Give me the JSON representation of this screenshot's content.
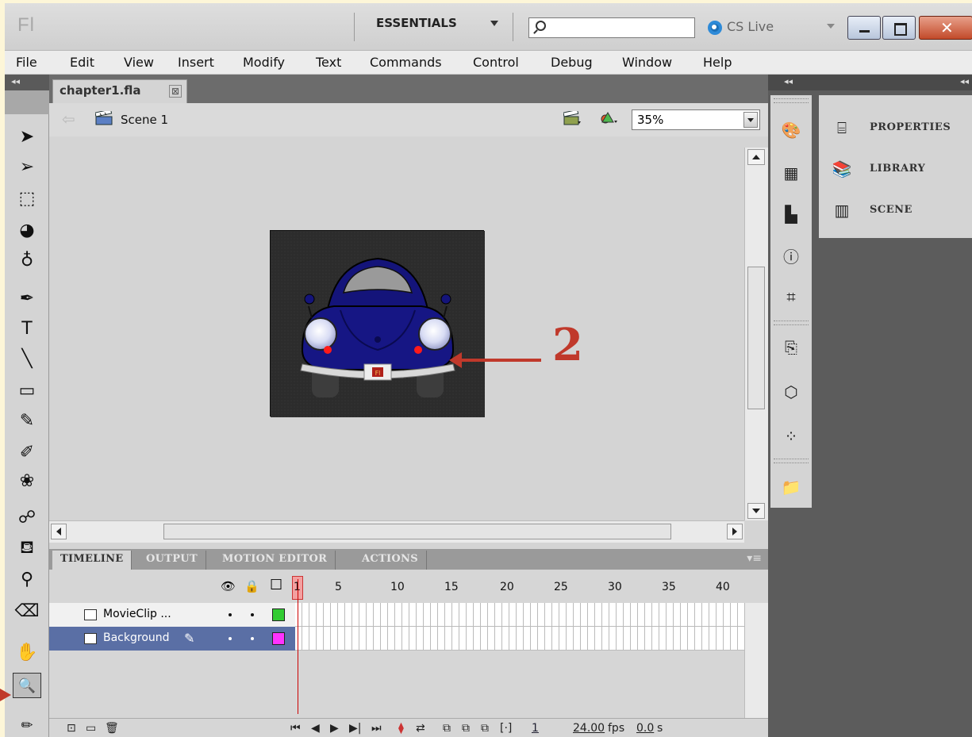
{
  "app": {
    "logo": "Fl",
    "workspace": "ESSENTIALS",
    "search_placeholder": "",
    "cs_live": "CS Live"
  },
  "menu": [
    "File",
    "Edit",
    "View",
    "Insert",
    "Modify",
    "Text",
    "Commands",
    "Control",
    "Debug",
    "Window",
    "Help"
  ],
  "toolbar": {
    "collapse_glyph": "◂◂",
    "tools": [
      {
        "name": "selection-tool-icon",
        "glyph": "➤"
      },
      {
        "name": "subselection-tool-icon",
        "glyph": "➢"
      },
      {
        "name": "free-transform-tool-icon",
        "glyph": "⬚"
      },
      {
        "name": "3d-rotation-tool-icon",
        "glyph": "◕"
      },
      {
        "name": "lasso-tool-icon",
        "glyph": "♁"
      },
      {
        "name": "pen-tool-icon",
        "glyph": "✒"
      },
      {
        "name": "text-tool-icon",
        "glyph": "T"
      },
      {
        "name": "line-tool-icon",
        "glyph": "╲"
      },
      {
        "name": "rectangle-tool-icon",
        "glyph": "▭"
      },
      {
        "name": "pencil-tool-icon",
        "glyph": "✎"
      },
      {
        "name": "brush-tool-icon",
        "glyph": "✐"
      },
      {
        "name": "deco-tool-icon",
        "glyph": "❀"
      },
      {
        "name": "bone-tool-icon",
        "glyph": "☍"
      },
      {
        "name": "paint-bucket-tool-icon",
        "glyph": "⛾"
      },
      {
        "name": "eyedropper-tool-icon",
        "glyph": "⚲"
      },
      {
        "name": "eraser-tool-icon",
        "glyph": "⌫"
      },
      {
        "name": "hand-tool-icon",
        "glyph": "✋"
      },
      {
        "name": "zoom-tool-icon",
        "glyph": "🔍"
      },
      {
        "name": "stroke-color-icon",
        "glyph": "✏"
      }
    ]
  },
  "document": {
    "tab_label": "chapter1.fla",
    "tab_close": "⊠",
    "scene_label": "Scene 1",
    "zoom": "35%"
  },
  "timeline": {
    "tabs": [
      "TIMELINE",
      "OUTPUT",
      "MOTION EDITOR",
      "ACTIONS"
    ],
    "frame_numbers": [
      "1",
      "5",
      "10",
      "15",
      "20",
      "25",
      "30",
      "35",
      "40"
    ],
    "layers": [
      {
        "name": "MovieClip ...",
        "color": "#33cc33",
        "selected": false
      },
      {
        "name": "Background",
        "color": "#ff33ff",
        "selected": true
      }
    ],
    "current_frame": "1",
    "fps": "24.00",
    "fps_unit": "fps",
    "time": "0.0",
    "time_unit": "s"
  },
  "dock": {
    "collapse_glyph": "◂◂",
    "panels": [
      {
        "label": "PROPERTIES",
        "icon": "properties-icon"
      },
      {
        "label": "LIBRARY",
        "icon": "library-icon"
      },
      {
        "label": "SCENE",
        "icon": "scene-panel-icon"
      }
    ]
  },
  "annotation": {
    "number": "2"
  },
  "colors": {
    "annotation_red": "#c0392b",
    "layer_selected": "#5a6fa5",
    "car_body": "#1a1a8a"
  }
}
